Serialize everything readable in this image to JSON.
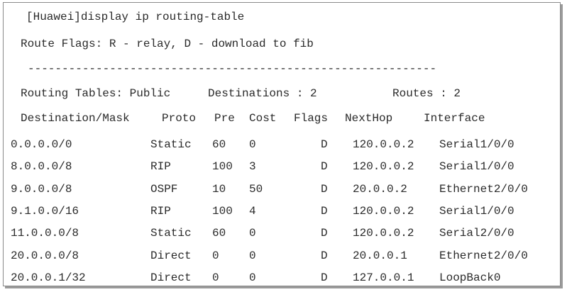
{
  "command": "[Huawei]display ip routing-table",
  "route_flags": "Route Flags: R - relay, D - download to fib",
  "separator": "------------------------------------------------------------",
  "summary": {
    "tables": "Routing Tables: Public",
    "destinations": "Destinations : 2",
    "routes": "Routes : 2"
  },
  "columns": [
    "Destination/Mask",
    "Proto",
    "Pre",
    "Cost",
    "Flags",
    "NextHop",
    "Interface"
  ],
  "rows": [
    [
      "0.0.0.0/0",
      "Static",
      "60",
      "0",
      "D",
      "120.0.0.2",
      "Serial1/0/0"
    ],
    [
      "8.0.0.0/8",
      "RIP",
      "100",
      "3",
      "D",
      "120.0.0.2",
      "Serial1/0/0"
    ],
    [
      "9.0.0.0/8",
      "OSPF",
      "10",
      "50",
      "D",
      "20.0.0.2",
      "Ethernet2/0/0"
    ],
    [
      "9.1.0.0/16",
      "RIP",
      "100",
      "4",
      "D",
      "120.0.0.2",
      "Serial1/0/0"
    ],
    [
      "11.0.0.0/8",
      "Static",
      "60",
      "0",
      "D",
      "120.0.0.2",
      "Serial2/0/0"
    ],
    [
      "20.0.0.0/8",
      "Direct",
      "0",
      "0",
      "D",
      "20.0.0.1",
      "Ethernet2/0/0"
    ],
    [
      "20.0.0.1/32",
      "Direct",
      "0",
      "0",
      "D",
      "127.0.0.1",
      "LoopBack0"
    ]
  ]
}
